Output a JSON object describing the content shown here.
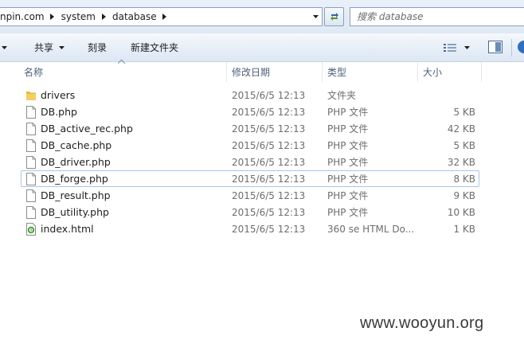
{
  "address_bar": {
    "crumbs": [
      "npin.com",
      "system",
      "database"
    ]
  },
  "search": {
    "placeholder": "搜索 database"
  },
  "toolbar": {
    "share_label": "共享",
    "burn_label": "刻录",
    "new_folder_label": "新建文件夹"
  },
  "columns": {
    "name": "名称",
    "date": "修改日期",
    "type": "类型",
    "size": "大小"
  },
  "files": [
    {
      "icon": "folder-icon",
      "name": "drivers",
      "date": "2015/6/5 12:13",
      "type": "文件夹",
      "size": ""
    },
    {
      "icon": "file-icon",
      "name": "DB.php",
      "date": "2015/6/5 12:13",
      "type": "PHP 文件",
      "size": "5 KB"
    },
    {
      "icon": "file-icon",
      "name": "DB_active_rec.php",
      "date": "2015/6/5 12:13",
      "type": "PHP 文件",
      "size": "42 KB"
    },
    {
      "icon": "file-icon",
      "name": "DB_cache.php",
      "date": "2015/6/5 12:13",
      "type": "PHP 文件",
      "size": "5 KB"
    },
    {
      "icon": "file-icon",
      "name": "DB_driver.php",
      "date": "2015/6/5 12:13",
      "type": "PHP 文件",
      "size": "32 KB"
    },
    {
      "icon": "file-icon",
      "name": "DB_forge.php",
      "date": "2015/6/5 12:13",
      "type": "PHP 文件",
      "size": "8 KB"
    },
    {
      "icon": "file-icon",
      "name": "DB_result.php",
      "date": "2015/6/5 12:13",
      "type": "PHP 文件",
      "size": "9 KB"
    },
    {
      "icon": "file-icon",
      "name": "DB_utility.php",
      "date": "2015/6/5 12:13",
      "type": "PHP 文件",
      "size": "10 KB"
    },
    {
      "icon": "html-file-icon",
      "name": "index.html",
      "date": "2015/6/5 12:13",
      "type": "360 se HTML Do...",
      "size": "1 KB"
    }
  ],
  "watermark": "www.wooyun.org",
  "colors": {
    "folder": "#e8b83a",
    "html_icon": "#3a9a2a",
    "focus_border": "#a9c6e8"
  }
}
